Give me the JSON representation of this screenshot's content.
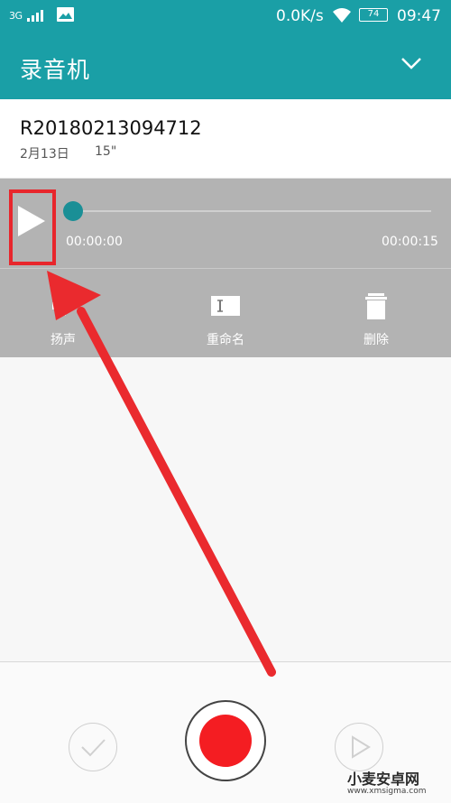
{
  "statusbar": {
    "network": "3G",
    "speed": "0.0K/s",
    "battery": "74",
    "time": "09:47",
    "icons": [
      "signal-icon",
      "image-icon",
      "wifi-icon",
      "battery-icon"
    ]
  },
  "appbar": {
    "title": "录音机",
    "menu_icon": "chevron-down-icon"
  },
  "recording": {
    "name": "R20180213094712",
    "date": "2月13日",
    "duration": "15\""
  },
  "player": {
    "current_time": "00:00:00",
    "total_time": "00:00:15",
    "progress": 0
  },
  "actions": [
    {
      "label": "扬声",
      "icon": "speaker-icon"
    },
    {
      "label": "重命名",
      "icon": "rename-icon"
    },
    {
      "label": "删除",
      "icon": "trash-icon"
    }
  ],
  "bottom_bar": {
    "buttons": [
      "check-icon",
      "record-icon",
      "play-list-icon"
    ]
  },
  "watermark": {
    "title": "小麦安卓网",
    "url": "www.xmsigma.com"
  },
  "colors": {
    "accent": "#1a9fa6",
    "record_red": "#f41d22",
    "annotation_red": "#e8262c"
  }
}
